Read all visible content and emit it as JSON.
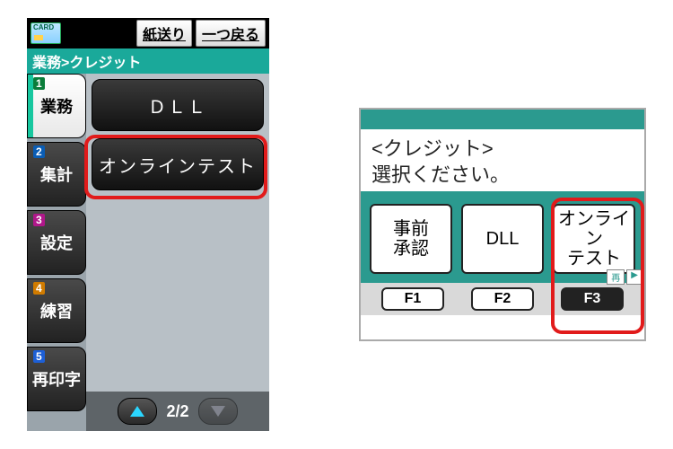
{
  "terminal_a": {
    "top_buttons": {
      "feed": "紙送り",
      "back": "一つ戻る"
    },
    "breadcrumb": "業務>クレジット",
    "sidebar": [
      {
        "num": "1",
        "label": "業務",
        "active": true
      },
      {
        "num": "2",
        "label": "集計"
      },
      {
        "num": "3",
        "label": "設定"
      },
      {
        "num": "4",
        "label": "練習"
      },
      {
        "num": "5",
        "label": "再印字"
      }
    ],
    "menu_items": [
      {
        "label": "ＤＬＬ"
      },
      {
        "label": "オンラインテスト",
        "highlighted": true
      }
    ],
    "pager": "2/2"
  },
  "terminal_b": {
    "title": "<クレジット>",
    "prompt": "選択ください。",
    "options": [
      {
        "label": "事前\n承認"
      },
      {
        "label": "DLL"
      },
      {
        "label": "オンライン\nテスト",
        "highlighted": true
      }
    ],
    "nav": {
      "redo": "再",
      "next": "▶"
    },
    "fkeys": [
      {
        "label": "F1"
      },
      {
        "label": "F2"
      },
      {
        "label": "F3",
        "dark": true
      }
    ]
  }
}
